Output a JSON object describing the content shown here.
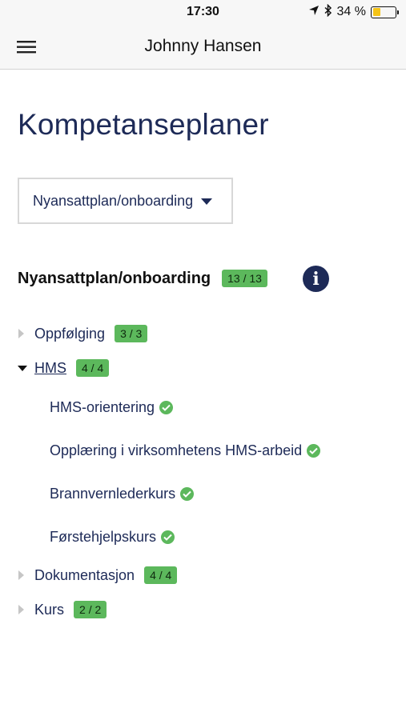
{
  "status_bar": {
    "time": "17:30",
    "battery": "34 %",
    "battery_level": 0.34,
    "icons": [
      "location-arrow-icon",
      "bluetooth-icon",
      "battery-icon"
    ]
  },
  "header": {
    "title": "Johnny Hansen",
    "menu_icon": "hamburger-menu-icon"
  },
  "page": {
    "title": "Kompetanseplaner"
  },
  "plan_select": {
    "selected": "Nyansattplan/onboarding"
  },
  "plan": {
    "title": "Nyansattplan/onboarding",
    "progress": "13 / 13",
    "info_icon": "info-icon"
  },
  "groups": [
    {
      "label": "Oppfølging",
      "progress": "3 / 3",
      "expanded": false
    },
    {
      "label": "HMS",
      "progress": "4 / 4",
      "expanded": true,
      "items": [
        {
          "label": "HMS-orientering",
          "completed": true
        },
        {
          "label": "Opplæring i virksomhetens HMS-arbeid",
          "completed": true
        },
        {
          "label": "Brannvernlederkurs",
          "completed": true
        },
        {
          "label": "Førstehjelpskurs",
          "completed": true
        }
      ]
    },
    {
      "label": "Dokumentasjon",
      "progress": "4 / 4",
      "expanded": false
    },
    {
      "label": "Kurs",
      "progress": "2 / 2",
      "expanded": false
    }
  ],
  "colors": {
    "navy": "#1d2a57",
    "badge_green": "#5cb85c",
    "battery_yellow": "#f5c418"
  }
}
